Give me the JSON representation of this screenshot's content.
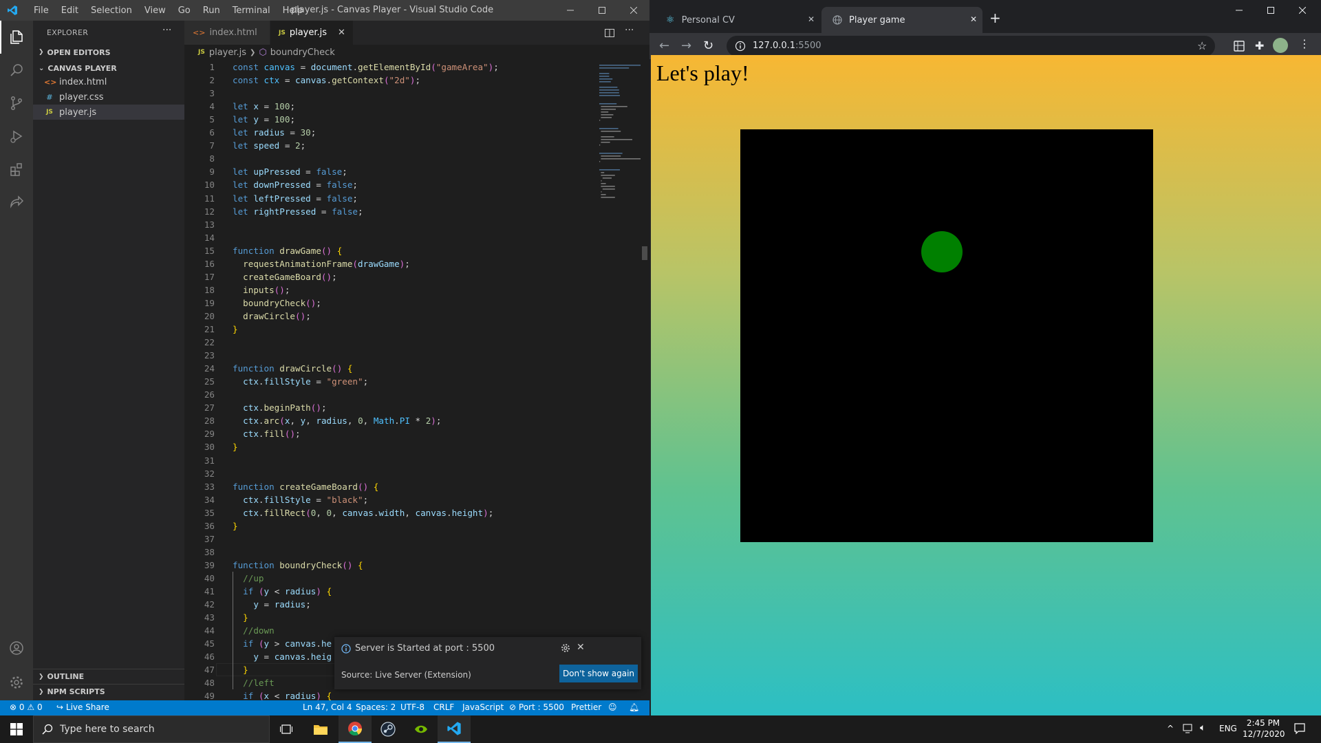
{
  "vscode": {
    "title": "player.js - Canvas Player - Visual Studio Code",
    "menu": [
      "File",
      "Edit",
      "Selection",
      "View",
      "Go",
      "Run",
      "Terminal",
      "Help"
    ],
    "sidebar": {
      "header": "EXPLORER",
      "open_editors": "OPEN EDITORS",
      "project": "CANVAS PLAYER",
      "files": [
        {
          "name": "index.html",
          "icon": "<>"
        },
        {
          "name": "player.css",
          "icon": "#"
        },
        {
          "name": "player.js",
          "icon": "JS"
        }
      ],
      "outline": "OUTLINE",
      "npm_scripts": "NPM SCRIPTS"
    },
    "tabs": [
      {
        "label": "index.html",
        "icon": "<>"
      },
      {
        "label": "player.js",
        "icon": "JS"
      }
    ],
    "breadcrumb": {
      "file": "player.js",
      "symbol": "boundryCheck"
    },
    "line_numbers": [
      "1",
      "2",
      "3",
      "4",
      "5",
      "6",
      "7",
      "8",
      "9",
      "10",
      "11",
      "12",
      "13",
      "14",
      "15",
      "16",
      "17",
      "18",
      "19",
      "20",
      "21",
      "22",
      "23",
      "24",
      "25",
      "26",
      "27",
      "28",
      "29",
      "30",
      "31",
      "32",
      "33",
      "34",
      "35",
      "36",
      "37",
      "38",
      "39",
      "40",
      "41",
      "42",
      "43",
      "44",
      "45",
      "46",
      "47",
      "48",
      "49"
    ],
    "code": [
      "const canvas = document.getElementById(\"gameArea\");",
      "const ctx = canvas.getContext(\"2d\");",
      "",
      "let x = 100;",
      "let y = 100;",
      "let radius = 30;",
      "let speed = 2;",
      "",
      "let upPressed = false;",
      "let downPressed = false;",
      "let leftPressed = false;",
      "let rightPressed = false;",
      "",
      "",
      "function drawGame() {",
      "  requestAnimationFrame(drawGame);",
      "  createGameBoard();",
      "  inputs();",
      "  boundryCheck();",
      "  drawCircle();",
      "}",
      "",
      "",
      "function drawCircle() {",
      "  ctx.fillStyle = \"green\";",
      "",
      "  ctx.beginPath();",
      "  ctx.arc(x, y, radius, 0, Math.PI * 2);",
      "  ctx.fill();",
      "}",
      "",
      "",
      "function createGameBoard() {",
      "  ctx.fillStyle = \"black\";",
      "  ctx.fillRect(0, 0, canvas.width, canvas.height);",
      "}",
      "",
      "",
      "function boundryCheck() {",
      "  //up",
      "  if (y < radius) {",
      "    y = radius;",
      "  }",
      "  //down",
      "  if (y > canvas.he",
      "    y = canvas.heig",
      "  }",
      "  //left",
      "  if (x < radius) {"
    ],
    "notification": {
      "message": "Server is Started at port : 5500",
      "source": "Source: Live Server (Extension)",
      "button": "Don't show again"
    },
    "status": {
      "errors": "0",
      "warnings": "0",
      "live_share": "Live Share",
      "position": "Ln 47, Col 4",
      "spaces": "Spaces: 2",
      "encoding": "UTF-8",
      "eol": "CRLF",
      "language": "JavaScript",
      "port": "Port : 5500",
      "prettier": "Prettier"
    }
  },
  "chrome": {
    "tabs": [
      {
        "title": "Personal CV",
        "active": false
      },
      {
        "title": "Player game",
        "active": true
      }
    ],
    "url": "127.0.0.1",
    "url_port": ":5500",
    "page_heading": "Let's play!"
  },
  "taskbar": {
    "search_placeholder": "Type here to search",
    "language": "ENG",
    "time": "2:45 PM",
    "date": "12/7/2020"
  },
  "colors": {
    "accent": "#007acc",
    "game_bg": "#000000",
    "ball": "#008000"
  }
}
